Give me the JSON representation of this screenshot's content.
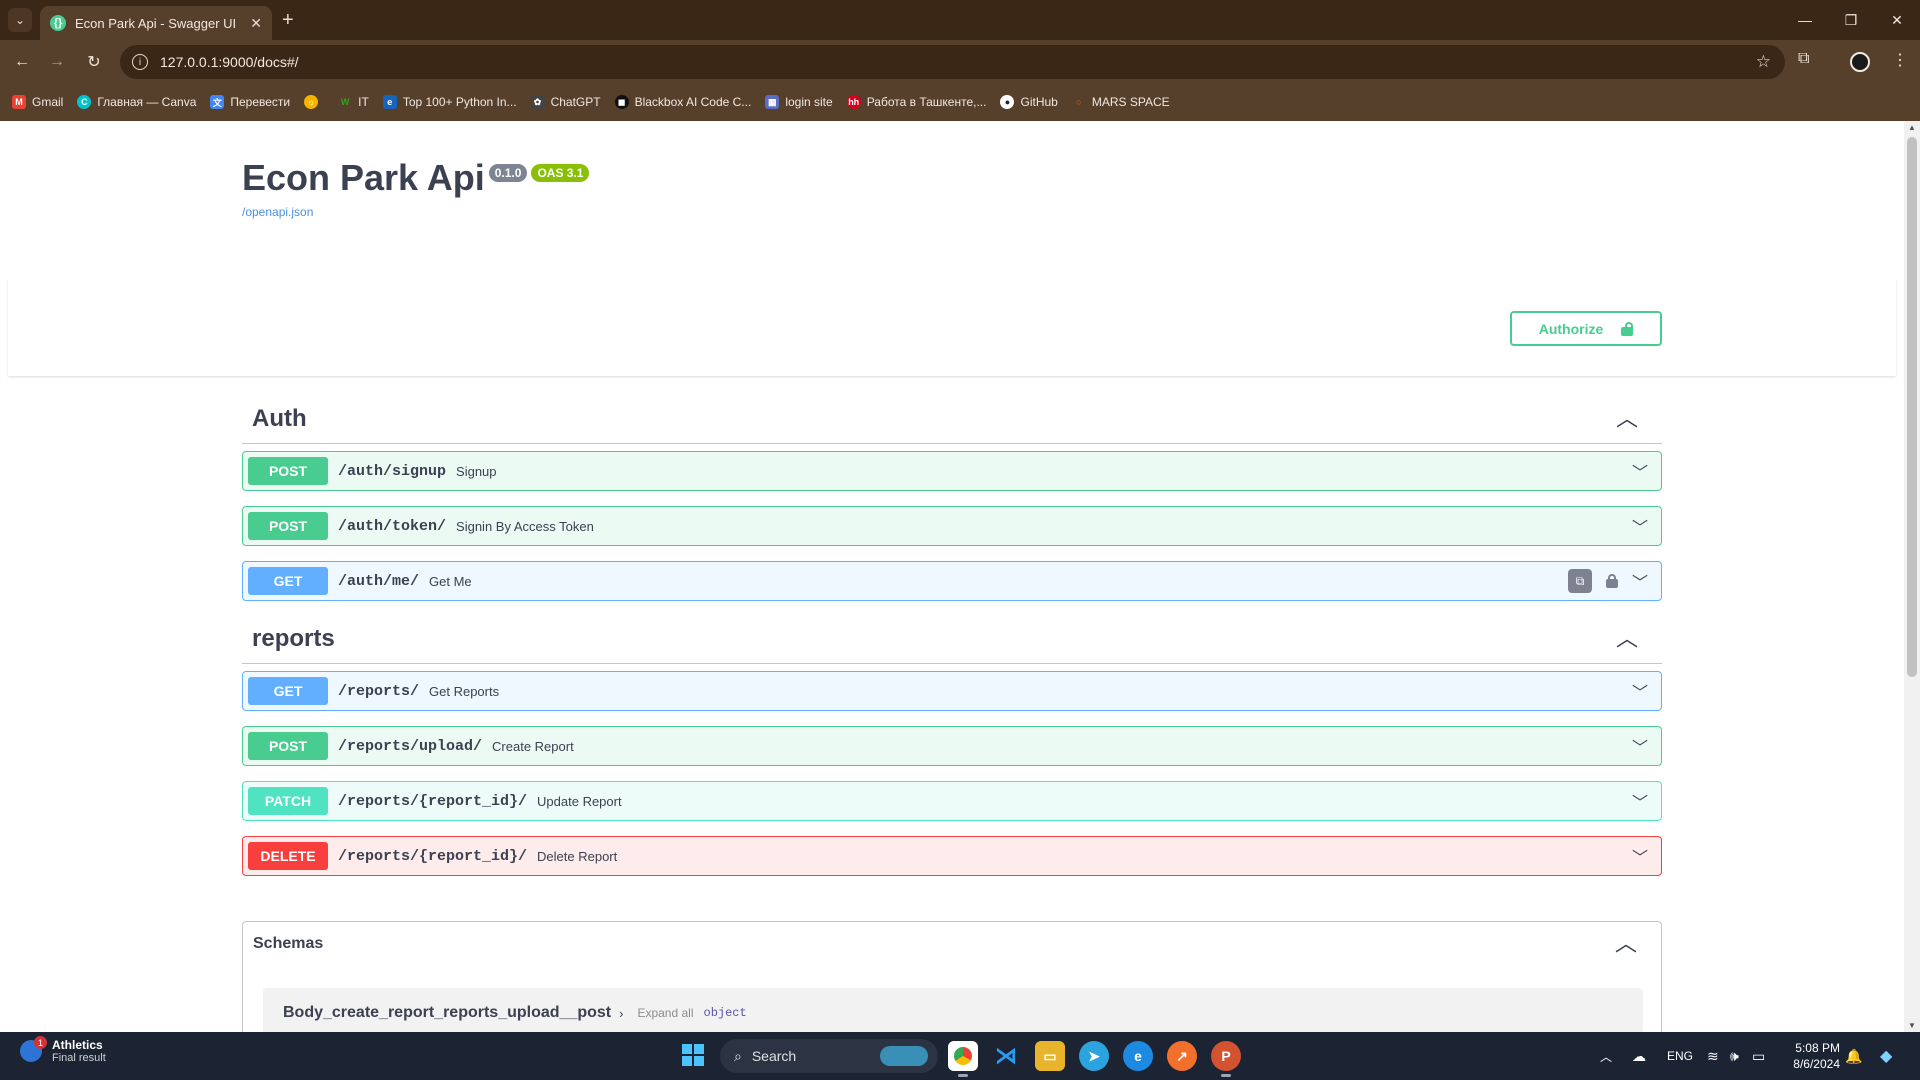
{
  "browser": {
    "tab_title": "Econ Park Api - Swagger UI",
    "url": "127.0.0.1:9000/docs#/",
    "bookmarks": [
      {
        "label": "Gmail",
        "color": "#ea4335"
      },
      {
        "label": "Главная — Canva",
        "color": "#00c4cc"
      },
      {
        "label": "Перевести",
        "color": "#4285f4"
      },
      {
        "label": "",
        "color": "#f4b400"
      },
      {
        "label": "IT",
        "color": "#3a9d23"
      },
      {
        "label": "Top 100+ Python In...",
        "color": "#1565c0"
      },
      {
        "label": "ChatGPT",
        "color": "#444444"
      },
      {
        "label": "Blackbox AI Code C...",
        "color": "#111111"
      },
      {
        "label": "login site",
        "color": "#5a6cc4"
      },
      {
        "label": "Работа в Ташкенте,...",
        "color": "#d6001c"
      },
      {
        "label": "GitHub",
        "color": "#222222"
      },
      {
        "label": "MARS SPACE",
        "color": "#f26522"
      }
    ]
  },
  "api": {
    "title": "Econ Park Api",
    "version": "0.1.0",
    "oas": "OAS 3.1",
    "spec_link": "/openapi.json",
    "authorize_label": "Authorize"
  },
  "tags": [
    {
      "name": "Auth",
      "operations": [
        {
          "method": "POST",
          "path": "/auth/signup",
          "summary": "Signup"
        },
        {
          "method": "POST",
          "path": "/auth/token/",
          "summary": "Signin By Access Token"
        },
        {
          "method": "GET",
          "path": "/auth/me/",
          "summary": "Get Me"
        }
      ]
    },
    {
      "name": "reports",
      "operations": [
        {
          "method": "GET",
          "path": "/reports/",
          "summary": "Get Reports"
        },
        {
          "method": "POST",
          "path": "/reports/upload/",
          "summary": "Create Report"
        },
        {
          "method": "PATCH",
          "path": "/reports/{report_id}/",
          "summary": "Update Report"
        },
        {
          "method": "DELETE",
          "path": "/reports/{report_id}/",
          "summary": "Delete Report"
        }
      ]
    }
  ],
  "schemas": {
    "title": "Schemas",
    "first_model": "Body_create_report_reports_upload__post",
    "expand_label": "Expand all",
    "type_label": "object"
  },
  "taskbar": {
    "weather_title": "Athletics",
    "weather_sub": "Final result",
    "badge": "1",
    "search_placeholder": "Search",
    "lang": "ENG",
    "time": "5:08 PM",
    "date": "8/6/2024"
  },
  "colors": {
    "post": "#49cc90",
    "get": "#61affe",
    "patch": "#50e3c2",
    "delete": "#f93e3e",
    "chrome": "#56402c"
  }
}
